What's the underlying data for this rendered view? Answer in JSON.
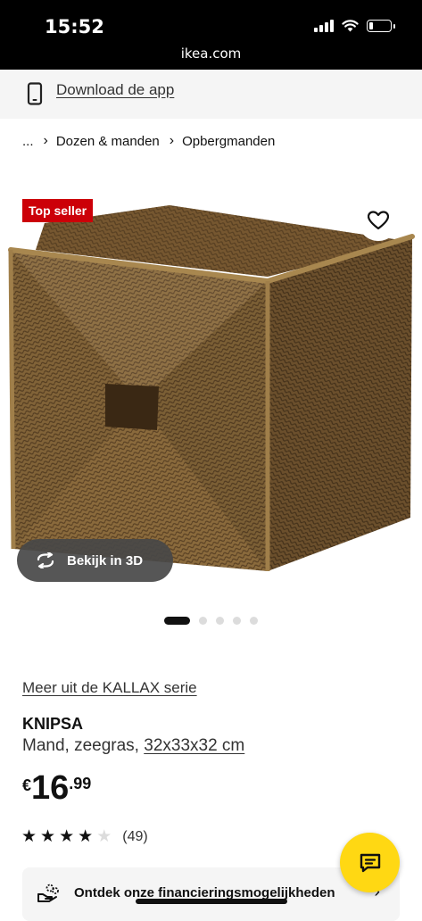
{
  "status_bar": {
    "time": "15:52",
    "url": "ikea.com",
    "battery_level": 0.2
  },
  "app_banner": {
    "link_label": "Download de app",
    "icon": "phone-icon"
  },
  "breadcrumb": {
    "ellipsis": "...",
    "items": [
      "Dozen & manden",
      "Opbergmanden"
    ]
  },
  "gallery": {
    "badge": "Top seller",
    "view_3d_label": "Bekijk in 3D",
    "favorite_icon": "heart-icon",
    "image_count": 5,
    "active_index": 0
  },
  "product": {
    "series_link": "Meer uit de KALLAX serie",
    "name": "KNIPSA",
    "description": "Mand, zeegras,",
    "dimensions": "32x33x32 cm",
    "price": {
      "currency": "€",
      "integer": "16",
      "decimal": ".99"
    },
    "rating": {
      "stars": 4,
      "max": 5,
      "count_label": "(49)"
    }
  },
  "finance": {
    "label": "Ontdek onze financieringsmogelijkheden",
    "icon": "hand-coins-icon",
    "arrow": "›"
  },
  "chat": {
    "icon": "chat-icon"
  },
  "colors": {
    "badge": "#cc0008",
    "chat": "#ffd813",
    "banner_bg": "#f5f5f5"
  }
}
